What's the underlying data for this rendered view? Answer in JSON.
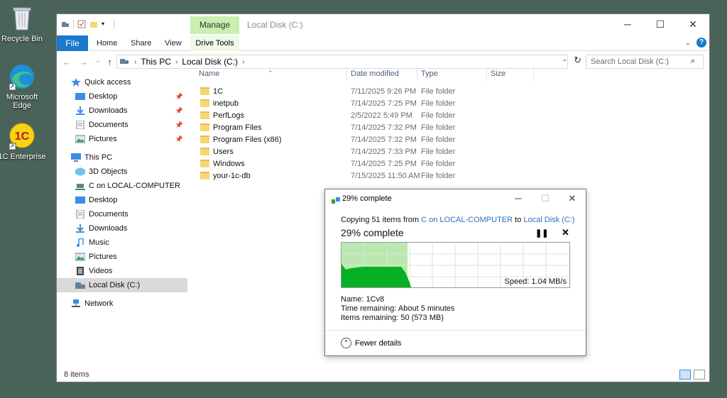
{
  "desktop": {
    "icons": [
      {
        "label": "Recycle Bin",
        "icon": "recycle-bin-icon"
      },
      {
        "label": "Microsoft Edge",
        "icon": "edge-icon"
      },
      {
        "label": "1C Enterprise",
        "icon": "1c-icon"
      }
    ]
  },
  "explorer": {
    "context_tab": "Manage",
    "title": "Local Disk (C:)",
    "caption": {
      "minimize": "─",
      "maximize": "☐",
      "close": "✕"
    },
    "ribbon_tabs": [
      "File",
      "Home",
      "Share",
      "View"
    ],
    "context_tab_sub": "Drive Tools",
    "address": {
      "crumbs": [
        "This PC",
        "Local Disk (C:)"
      ]
    },
    "search_placeholder": "Search Local Disk (C:)",
    "nav": {
      "quick_access": "Quick access",
      "quick_items": [
        "Desktop",
        "Downloads",
        "Documents",
        "Pictures"
      ],
      "this_pc": "This PC",
      "pc_items": [
        "3D Objects",
        "C on LOCAL-COMPUTER",
        "Desktop",
        "Documents",
        "Downloads",
        "Music",
        "Pictures",
        "Videos",
        "Local Disk (C:)"
      ],
      "network": "Network"
    },
    "columns": [
      "Name",
      "Date modified",
      "Type",
      "Size"
    ],
    "files": [
      {
        "name": "1C",
        "date": "7/11/2025 9:26 PM",
        "type": "File folder"
      },
      {
        "name": "inetpub",
        "date": "7/14/2025 7:25 PM",
        "type": "File folder"
      },
      {
        "name": "PerfLogs",
        "date": "2/5/2022 5:49 PM",
        "type": "File folder"
      },
      {
        "name": "Program Files",
        "date": "7/14/2025 7:32 PM",
        "type": "File folder"
      },
      {
        "name": "Program Files (x86)",
        "date": "7/14/2025 7:32 PM",
        "type": "File folder"
      },
      {
        "name": "Users",
        "date": "7/14/2025 7:33 PM",
        "type": "File folder"
      },
      {
        "name": "Windows",
        "date": "7/14/2025 7:25 PM",
        "type": "File folder"
      },
      {
        "name": "your-1c-db",
        "date": "7/15/2025 11:50 AM",
        "type": "File folder"
      }
    ],
    "status": "8 items"
  },
  "copy_dialog": {
    "title": "29% complete",
    "copying_prefix": "Copying 51 items from ",
    "source": "C on LOCAL-COMPUTER",
    "to_word": " to ",
    "dest": "Local Disk (C:)",
    "progress_title": "29% complete",
    "progress_fraction": 0.29,
    "speed": "Speed: 1.04 MB/s",
    "name_line": "Name:  1Cv8",
    "time_line": "Time remaining:  About 5 minutes",
    "items_line": "Items remaining:  50 (573 MB)",
    "fewer_details": "Fewer details",
    "progress_color": "#06b025"
  }
}
